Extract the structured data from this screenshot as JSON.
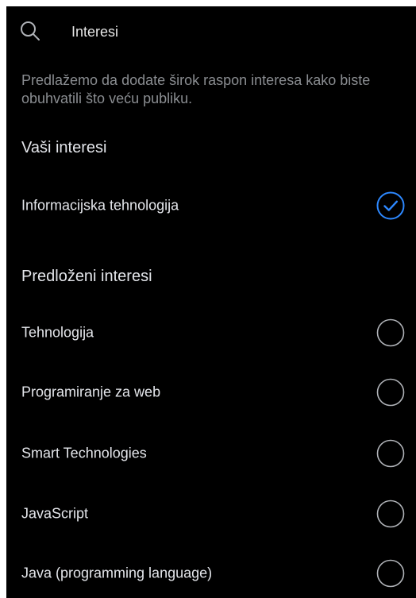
{
  "colors": {
    "background": "#000000",
    "text_primary": "#e4e6eb",
    "text_secondary": "#8a8d91",
    "accent_blue": "#2d88ff",
    "radio_outline": "#b0b3b8"
  },
  "search": {
    "icon": "search-icon",
    "value": "Interesi",
    "placeholder": "Interesi"
  },
  "hint": "Predlažemo da dodate širok raspon interesa kako biste obuhvatili što veću publiku.",
  "your_interests": {
    "title": "Vaši interesi",
    "items": [
      {
        "label": "Informacijska tehnologija",
        "selected": true,
        "icon": "check-circle-icon"
      }
    ]
  },
  "suggested_interests": {
    "title": "Predloženi interesi",
    "items": [
      {
        "label": "Tehnologija",
        "selected": false,
        "icon": "radio-empty-icon"
      },
      {
        "label": "Programiranje za web",
        "selected": false,
        "icon": "radio-empty-icon"
      },
      {
        "label": "Smart Technologies",
        "selected": false,
        "icon": "radio-empty-icon"
      },
      {
        "label": "JavaScript",
        "selected": false,
        "icon": "radio-empty-icon"
      },
      {
        "label": "Java (programming language)",
        "selected": false,
        "icon": "radio-empty-icon"
      }
    ]
  }
}
